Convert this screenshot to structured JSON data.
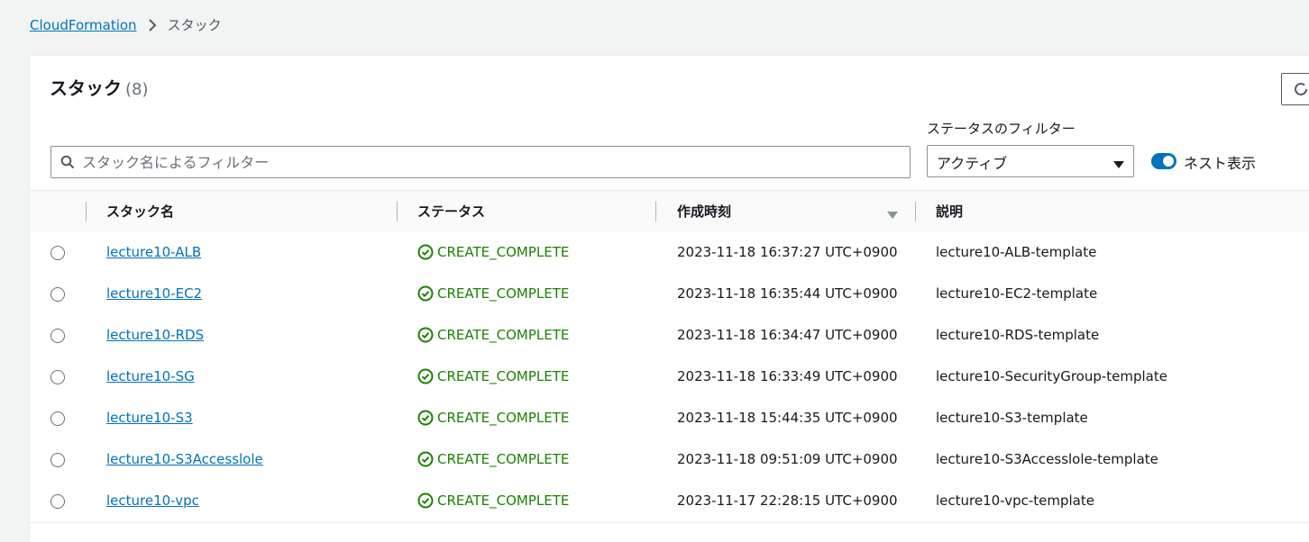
{
  "breadcrumb": {
    "root": "CloudFormation",
    "current": "スタック"
  },
  "panel": {
    "title": "スタック",
    "count": "(8)"
  },
  "search": {
    "placeholder": "スタック名によるフィルター"
  },
  "status_filter": {
    "label": "ステータスのフィルター",
    "selected": "アクティブ"
  },
  "nested_toggle": {
    "label": "ネスト表示",
    "on": true
  },
  "table": {
    "columns": [
      "スタック名",
      "ステータス",
      "作成時刻",
      "説明"
    ],
    "rows": [
      {
        "name": "lecture10-ALB",
        "status": "CREATE_COMPLETE",
        "created": "2023-11-18 16:37:27 UTC+0900",
        "description": "lecture10-ALB-template"
      },
      {
        "name": "lecture10-EC2",
        "status": "CREATE_COMPLETE",
        "created": "2023-11-18 16:35:44 UTC+0900",
        "description": "lecture10-EC2-template"
      },
      {
        "name": "lecture10-RDS",
        "status": "CREATE_COMPLETE",
        "created": "2023-11-18 16:34:47 UTC+0900",
        "description": "lecture10-RDS-template"
      },
      {
        "name": "lecture10-SG",
        "status": "CREATE_COMPLETE",
        "created": "2023-11-18 16:33:49 UTC+0900",
        "description": "lecture10-SecurityGroup-template"
      },
      {
        "name": "lecture10-S3",
        "status": "CREATE_COMPLETE",
        "created": "2023-11-18 15:44:35 UTC+0900",
        "description": "lecture10-S3-template"
      },
      {
        "name": "lecture10-S3Accesslole",
        "status": "CREATE_COMPLETE",
        "created": "2023-11-18 09:51:09 UTC+0900",
        "description": "lecture10-S3Accesslole-template"
      },
      {
        "name": "lecture10-vpc",
        "status": "CREATE_COMPLETE",
        "created": "2023-11-17 22:28:15 UTC+0900",
        "description": "lecture10-vpc-template"
      }
    ]
  },
  "colors": {
    "link": "#0073bb",
    "success": "#1d8102",
    "toggle_on": "#0073bb"
  },
  "icons": {
    "breadcrumb_separator": "chevron-right-icon",
    "search": "search-icon",
    "select_caret": "caret-down-icon",
    "status_ok": "check-circle-icon",
    "sort": "sort-descending-icon",
    "refresh": "refresh-icon"
  }
}
